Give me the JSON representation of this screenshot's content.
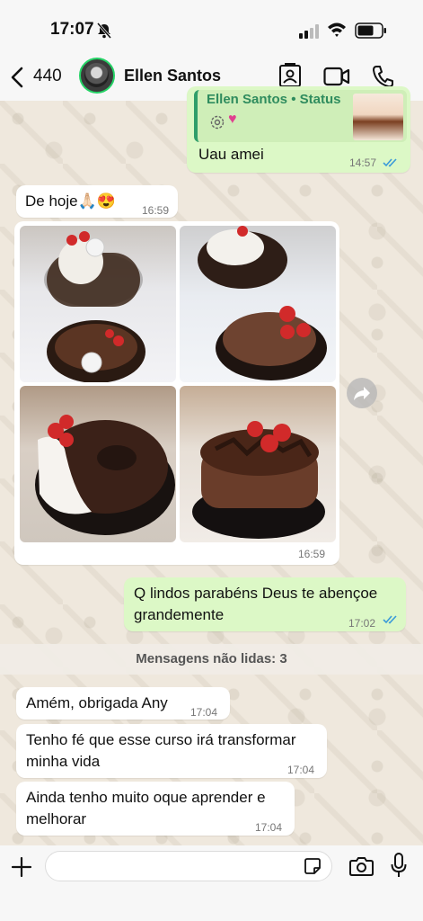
{
  "status_bar": {
    "time": "17:07"
  },
  "header": {
    "unread_count": "440",
    "contact_name": "Ellen Santos"
  },
  "messages": {
    "status_reply": {
      "quote_title": "Ellen Santos • Status",
      "text": "Uau amei",
      "time": "14:57"
    },
    "de_hoje": {
      "text": "De hoje🙏🏻😍",
      "time": "16:59"
    },
    "photo_album": {
      "time": "16:59"
    },
    "lindos": {
      "text_line1": "Q lindos parabéns Deus te abençoe",
      "text_line2": "grandemente",
      "time": "17:02"
    },
    "unread_divider": "Mensagens não lidas: 3",
    "amem": {
      "text": "Amém, obrigada Any",
      "time": "17:04"
    },
    "curso": {
      "text_line1": "Tenho fé que esse curso irá transformar",
      "text_line2": "minha vida",
      "time": "17:04"
    },
    "aprender": {
      "text_line1": "Ainda tenho muito oque aprender e",
      "text_line2": "melhorar",
      "time": "17:04"
    }
  },
  "input": {
    "placeholder": ""
  },
  "colors": {
    "outgoing_bubble": "#dcf8c6",
    "incoming_bubble": "#ffffff",
    "read_ticks": "#3a9ad9",
    "whatsapp_green": "#25d366"
  }
}
